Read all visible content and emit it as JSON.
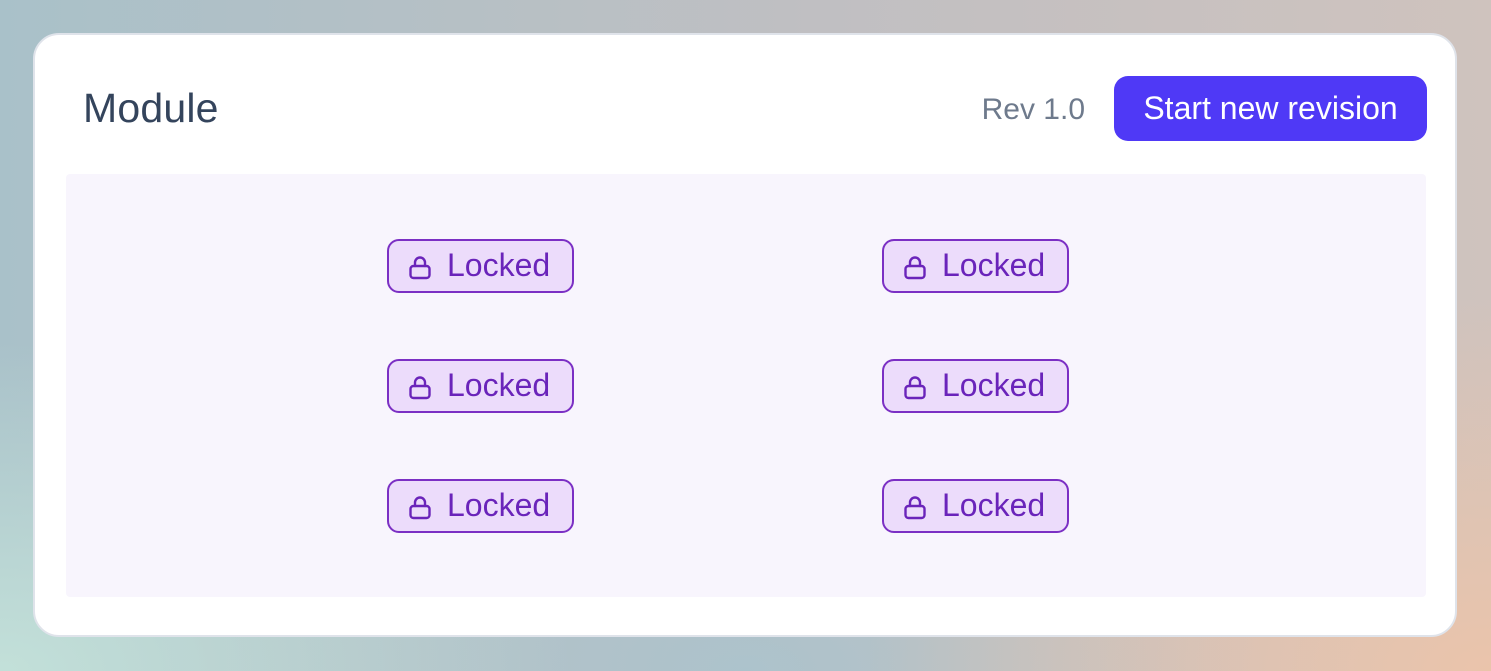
{
  "header": {
    "title": "Module",
    "revision": "Rev 1.0",
    "new_revision_button": "Start new revision"
  },
  "badges": [
    {
      "label": "Locked",
      "icon": "lock-icon"
    },
    {
      "label": "Locked",
      "icon": "lock-icon"
    },
    {
      "label": "Locked",
      "icon": "lock-icon"
    },
    {
      "label": "Locked",
      "icon": "lock-icon"
    },
    {
      "label": "Locked",
      "icon": "lock-icon"
    },
    {
      "label": "Locked",
      "icon": "lock-icon"
    }
  ],
  "colors": {
    "accent": "#4f39f6",
    "badge_border": "#7b2fc4",
    "badge_fill": "#ecdcfb",
    "badge_text": "#6a24ba",
    "panel_background": "#f8f5fd"
  }
}
